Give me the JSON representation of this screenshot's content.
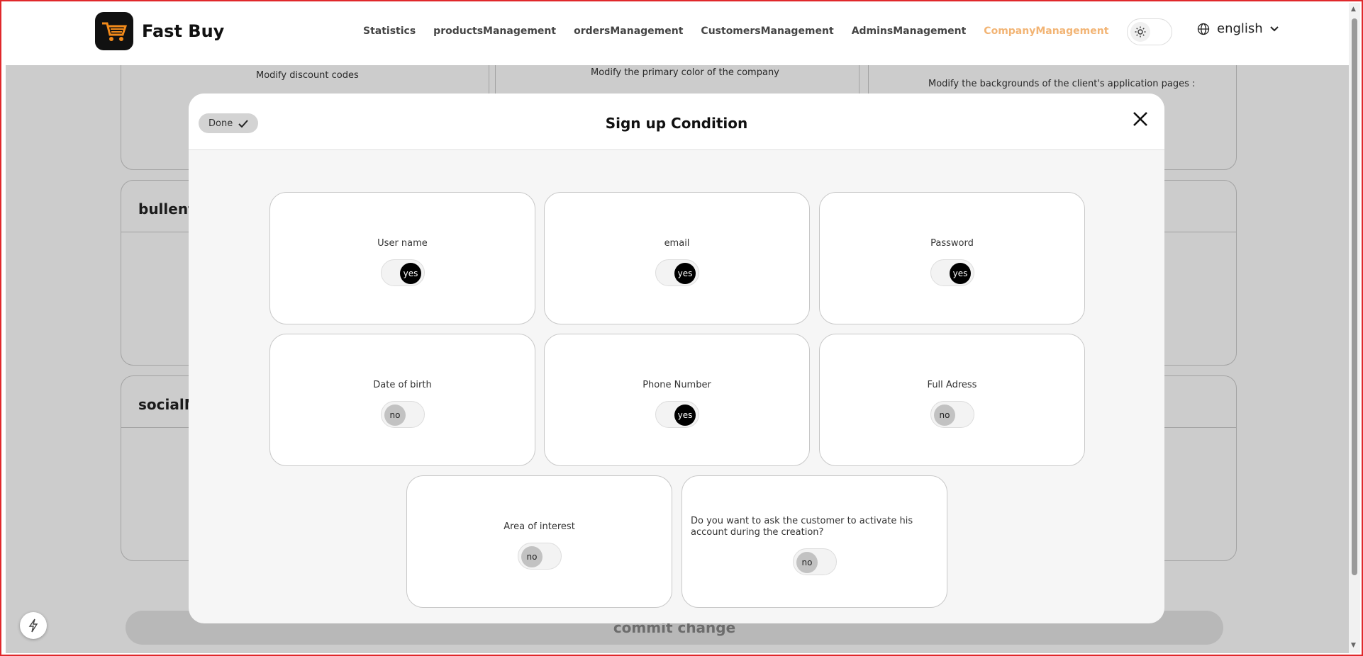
{
  "app": {
    "name": "Fast Buy"
  },
  "nav": [
    {
      "label": "Statistics",
      "active": false
    },
    {
      "label": "productsManagement",
      "active": false
    },
    {
      "label": "ordersManagement",
      "active": false
    },
    {
      "label": "CustomersManagement",
      "active": false
    },
    {
      "label": "AdminsManagement",
      "active": false
    },
    {
      "label": "CompanyManagement",
      "active": true
    }
  ],
  "language": {
    "selected": "english"
  },
  "background": {
    "cards": {
      "discount": "Modify discount codes",
      "primary_color": "Modify the primary color of the company",
      "backgrounds": "Modify the backgrounds of the client's application pages :",
      "bulletin_title": "bullenti",
      "social_title": "socialMe"
    },
    "commit_label": "commit change"
  },
  "modal": {
    "title": "Sign up Condition",
    "done_label": "Done",
    "options": [
      {
        "label": "User name",
        "value": "yes"
      },
      {
        "label": "email",
        "value": "yes"
      },
      {
        "label": "Password",
        "value": "yes"
      },
      {
        "label": "Date of birth",
        "value": "no"
      },
      {
        "label": "Phone Number",
        "value": "yes"
      },
      {
        "label": "Full Adress",
        "value": "no"
      },
      {
        "label": "Area of interest",
        "value": "no"
      },
      {
        "label": "Do you want to ask the customer to activate his account during the creation?",
        "value": "no"
      }
    ]
  },
  "colors": {
    "accent": "#f2b474",
    "toggle_on": "#000000",
    "toggle_off": "#c2c2c2"
  }
}
